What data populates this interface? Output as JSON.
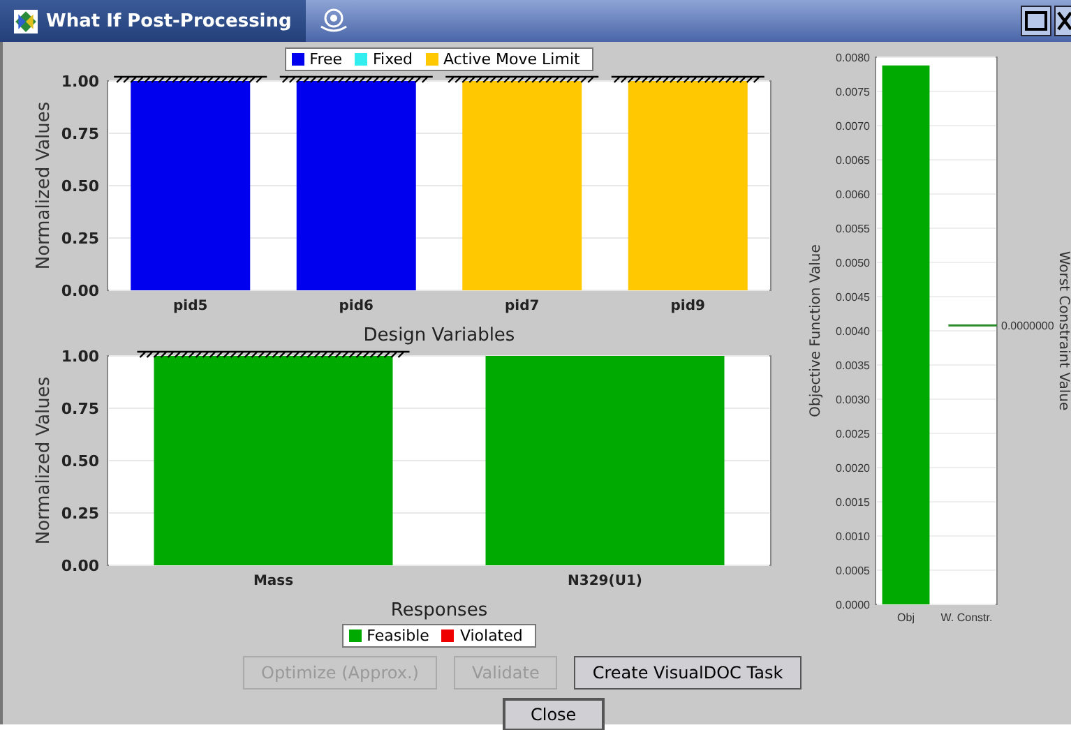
{
  "window": {
    "title": "What If Post-Processing"
  },
  "design_variables": {
    "upper_bound_marks": [
      true,
      true,
      true,
      true
    ],
    "chart_data": {
      "type": "bar",
      "grid": true,
      "xlabel": "Design Variables",
      "ylabel": "Normalized Values",
      "categories": [
        "pid5",
        "pid6",
        "pid7",
        "pid9"
      ],
      "ylim": [
        0,
        1
      ],
      "yticks": [
        {
          "value": 0,
          "label": "0.00"
        },
        {
          "value": 0.25,
          "label": "0.25"
        },
        {
          "value": 0.5,
          "label": "0.50"
        },
        {
          "value": 0.75,
          "label": "0.75"
        },
        {
          "value": 1,
          "label": "1.00"
        }
      ],
      "series": [
        {
          "name": "Free",
          "color": "#0000ee",
          "values": [
            1,
            1,
            null,
            null
          ]
        },
        {
          "name": "Fixed",
          "color": "#33eeee",
          "values": [
            null,
            null,
            null,
            null
          ]
        },
        {
          "name": "Active Move Limit",
          "color": "#ffc800",
          "values": [
            null,
            null,
            1,
            1
          ]
        }
      ]
    }
  },
  "responses": {
    "upper_bound_marks": [
      true,
      false
    ],
    "chart_data": {
      "type": "bar",
      "grid": true,
      "xlabel": "Responses",
      "ylabel": "Normalized Values",
      "categories": [
        "Mass",
        "N329(U1)"
      ],
      "ylim": [
        0,
        1
      ],
      "yticks": [
        {
          "value": 0,
          "label": "0.00"
        },
        {
          "value": 0.25,
          "label": "0.25"
        },
        {
          "value": 0.5,
          "label": "0.50"
        },
        {
          "value": 0.75,
          "label": "0.75"
        },
        {
          "value": 1,
          "label": "1.00"
        }
      ],
      "series": [
        {
          "name": "Feasible",
          "color": "#00aa00",
          "values": [
            1,
            1
          ]
        },
        {
          "name": "Violated",
          "color": "#ee0000",
          "values": [
            null,
            null
          ]
        }
      ]
    }
  },
  "objective": {
    "chart_data": {
      "type": "bar",
      "grid": true,
      "ylabel": "Objective Function Value",
      "categories": [
        "Obj",
        "W. Constr."
      ],
      "ylim": [
        0,
        0.008
      ],
      "yticks": [
        {
          "value": 0,
          "label": "0.0000"
        },
        {
          "value": 0.0005,
          "label": "0.0005"
        },
        {
          "value": 0.001,
          "label": "0.0010"
        },
        {
          "value": 0.0015,
          "label": "0.0015"
        },
        {
          "value": 0.002,
          "label": "0.0020"
        },
        {
          "value": 0.0025,
          "label": "0.0025"
        },
        {
          "value": 0.003,
          "label": "0.0030"
        },
        {
          "value": 0.0035,
          "label": "0.0035"
        },
        {
          "value": 0.004,
          "label": "0.0040"
        },
        {
          "value": 0.0045,
          "label": "0.0045"
        },
        {
          "value": 0.005,
          "label": "0.0050"
        },
        {
          "value": 0.0055,
          "label": "0.0055"
        },
        {
          "value": 0.006,
          "label": "0.0060"
        },
        {
          "value": 0.0065,
          "label": "0.0065"
        },
        {
          "value": 0.007,
          "label": "0.0070"
        },
        {
          "value": 0.0075,
          "label": "0.0075"
        },
        {
          "value": 0.008,
          "label": "0.0080"
        }
      ],
      "series": [
        {
          "color": "#00aa00",
          "values": [
            0.00788,
            null
          ]
        }
      ]
    },
    "worst_constraint": {
      "label": "Worst Constraint Value",
      "value_label": "0.0000000"
    }
  },
  "buttons": [
    {
      "label": "Optimize (Approx.)",
      "disabled": true
    },
    {
      "label": "Validate",
      "disabled": true
    },
    {
      "label": "Create VisualDOC Task",
      "disabled": false
    }
  ],
  "close_button": {
    "label": "Close"
  }
}
